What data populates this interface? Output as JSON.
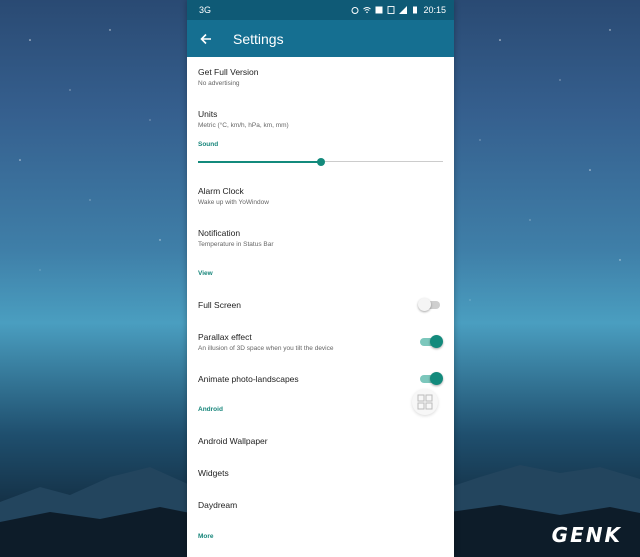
{
  "statusbar": {
    "network": "3G",
    "time": "20:15"
  },
  "appbar": {
    "title": "Settings"
  },
  "items": {
    "full_version": {
      "label": "Get Full Version",
      "sub": "No advertising"
    },
    "units": {
      "label": "Units",
      "sub": "Metric (°C, km/h, hPa, km, mm)"
    },
    "sound_category": "Sound",
    "sound_level_percent": 50,
    "alarm": {
      "label": "Alarm Clock",
      "sub": "Wake up with YoWindow"
    },
    "notification": {
      "label": "Notification",
      "sub": "Temperature in Status Bar"
    },
    "view_category": "View",
    "full_screen": {
      "label": "Full Screen",
      "enabled": false
    },
    "parallax": {
      "label": "Parallax effect",
      "sub": "An illusion of 3D space when you tilt the device",
      "enabled": true
    },
    "animate": {
      "label": "Animate photo-landscapes",
      "enabled": true
    },
    "android_category": "Android",
    "wallpaper": {
      "label": "Android Wallpaper"
    },
    "widgets": {
      "label": "Widgets"
    },
    "daydream": {
      "label": "Daydream"
    },
    "more_category": "More"
  },
  "colors": {
    "appbar": "#156f91",
    "statusbar": "#0f5a76",
    "accent": "#138a7c"
  },
  "watermark": "GENK"
}
